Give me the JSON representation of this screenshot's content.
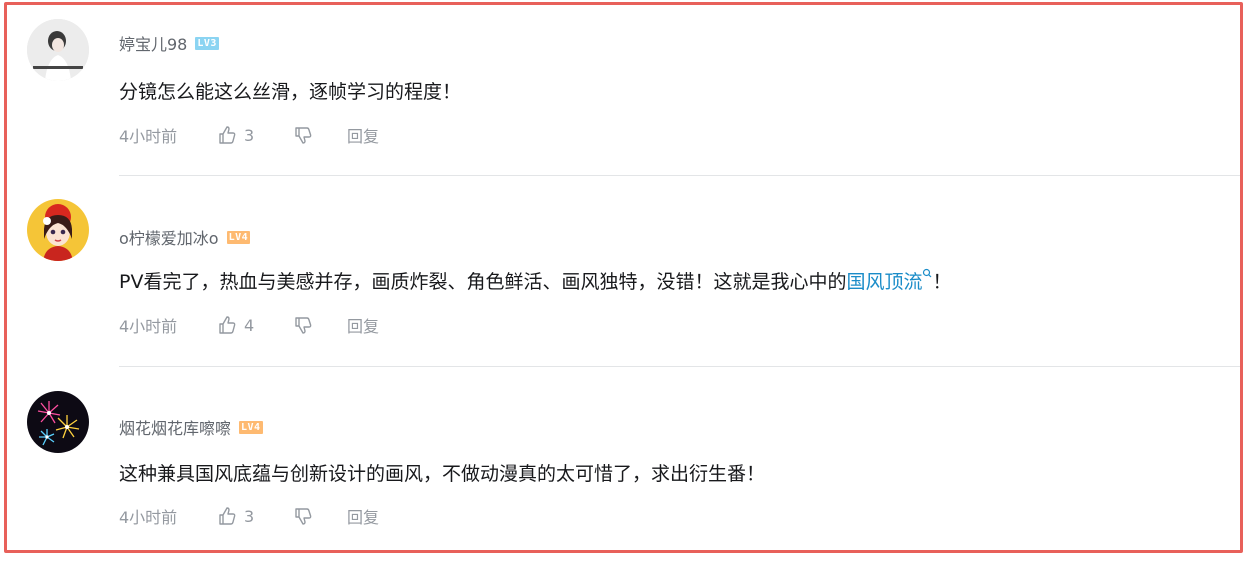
{
  "comments": [
    {
      "username": "婷宝儿98",
      "level": "LV3",
      "level_color": "#8bd4f2",
      "text": "分镜怎么能这么丝滑，逐帧学习的程度！",
      "time": "4小时前",
      "likes": "3",
      "reply_label": "回复"
    },
    {
      "username": "o柠檬爱加冰o",
      "level": "LV4",
      "level_color": "#feba71",
      "text_before": "PV看完了，热血与美感并存，画质炸裂、角色鲜活、画风独特，没错！这就是我心中的",
      "link_text": "国风顶流",
      "text_after": "！",
      "time": "4小时前",
      "likes": "4",
      "reply_label": "回复"
    },
    {
      "username": "烟花烟花库嚓嚓",
      "level": "LV4",
      "level_color": "#feba71",
      "text": "这种兼具国风底蕴与创新设计的画风，不做动漫真的太可惜了，求出衍生番！",
      "time": "4小时前",
      "likes": "3",
      "reply_label": "回复"
    }
  ],
  "icons": {
    "like": "thumb-up-icon",
    "dislike": "thumb-down-icon",
    "search": "search-icon"
  },
  "colors": {
    "frame": "#e8605a",
    "link": "#1a8cc8",
    "meta": "#9499a0"
  }
}
